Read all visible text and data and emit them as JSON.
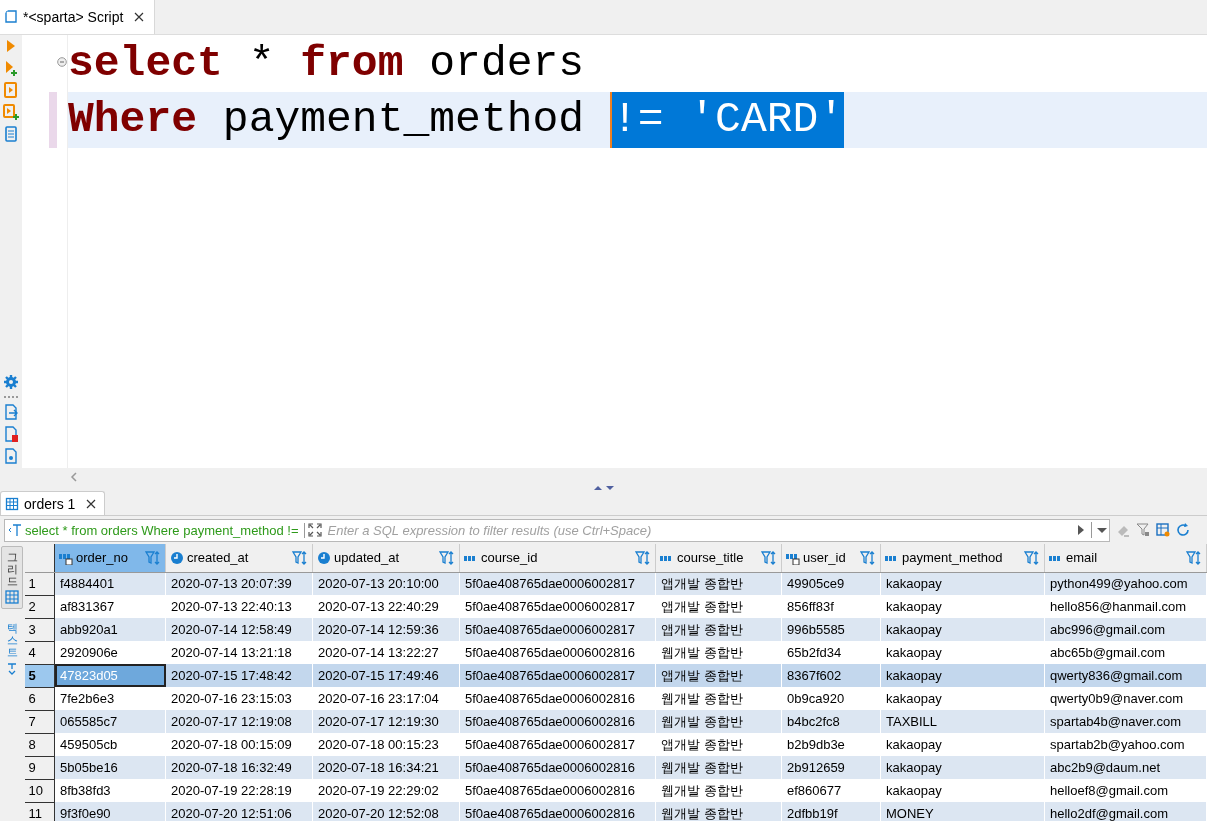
{
  "editor_tab": {
    "label": "*<sparta> Script",
    "selected": true
  },
  "editor": {
    "lines": [
      {
        "current": false,
        "folding": true,
        "changed": false,
        "tokens": [
          {
            "kind": "keyword",
            "text": "select"
          },
          {
            "kind": "plain",
            "text": " * "
          },
          {
            "kind": "keyword",
            "text": "from"
          },
          {
            "kind": "plain",
            "text": " orders"
          }
        ]
      },
      {
        "current": true,
        "folding": false,
        "changed": true,
        "tokens": [
          {
            "kind": "keyword",
            "text": "Where"
          },
          {
            "kind": "plain",
            "text": " payment_method "
          },
          {
            "kind": "selected",
            "text": "!= 'CARD'"
          }
        ]
      }
    ]
  },
  "results_tab": {
    "label": "orders 1",
    "selected": true
  },
  "filter": {
    "query": "select * from orders Where payment_method !=",
    "placeholder": "Enter a SQL expression to filter results (use Ctrl+Space)"
  },
  "view_tabs": [
    {
      "label": "그리드",
      "selected": true
    },
    {
      "label": "텍스트",
      "selected": false
    }
  ],
  "columns": [
    {
      "name": "order_no",
      "kind": "key",
      "selected": true
    },
    {
      "name": "created_at",
      "kind": "datetime",
      "selected": false
    },
    {
      "name": "updated_at",
      "kind": "datetime",
      "selected": false
    },
    {
      "name": "course_id",
      "kind": "text",
      "selected": false
    },
    {
      "name": "course_title",
      "kind": "text",
      "selected": false
    },
    {
      "name": "user_id",
      "kind": "key",
      "selected": false
    },
    {
      "name": "payment_method",
      "kind": "text",
      "selected": false
    },
    {
      "name": "email",
      "kind": "text",
      "selected": false
    }
  ],
  "rows": [
    {
      "number": "1",
      "selected": false,
      "cells": [
        "f4884401",
        "2020-07-13 20:07:39",
        "2020-07-13 20:10:00",
        "5f0ae408765dae0006002817",
        "앱개발 종합반",
        "49905ce9",
        "kakaopay",
        "python499@yahoo.com"
      ]
    },
    {
      "number": "2",
      "selected": false,
      "cells": [
        "af831367",
        "2020-07-13 22:40:13",
        "2020-07-13 22:40:29",
        "5f0ae408765dae0006002817",
        "앱개발 종합반",
        "856ff83f",
        "kakaopay",
        "hello856@hanmail.com"
      ]
    },
    {
      "number": "3",
      "selected": false,
      "cells": [
        "abb920a1",
        "2020-07-14 12:58:49",
        "2020-07-14 12:59:36",
        "5f0ae408765dae0006002817",
        "앱개발 종합반",
        "996b5585",
        "kakaopay",
        "abc996@gmail.com"
      ]
    },
    {
      "number": "4",
      "selected": false,
      "cells": [
        "2920906e",
        "2020-07-14 13:21:18",
        "2020-07-14 13:22:27",
        "5f0ae408765dae0006002816",
        "웹개발 종합반",
        "65b2fd34",
        "kakaopay",
        "abc65b@gmail.com"
      ]
    },
    {
      "number": "5",
      "selected": true,
      "cells": [
        "47823d05",
        "2020-07-15 17:48:42",
        "2020-07-15 17:49:46",
        "5f0ae408765dae0006002817",
        "앱개발 종합반",
        "8367f602",
        "kakaopay",
        "qwerty836@gmail.com"
      ]
    },
    {
      "number": "6",
      "selected": false,
      "cells": [
        "7fe2b6e3",
        "2020-07-16 23:15:03",
        "2020-07-16 23:17:04",
        "5f0ae408765dae0006002816",
        "웹개발 종합반",
        "0b9ca920",
        "kakaopay",
        "qwerty0b9@naver.com"
      ]
    },
    {
      "number": "7",
      "selected": false,
      "cells": [
        "065585c7",
        "2020-07-17 12:19:08",
        "2020-07-17 12:19:30",
        "5f0ae408765dae0006002816",
        "웹개발 종합반",
        "b4bc2fc8",
        "TAXBILL",
        "spartab4b@naver.com"
      ]
    },
    {
      "number": "8",
      "selected": false,
      "cells": [
        "459505cb",
        "2020-07-18 00:15:09",
        "2020-07-18 00:15:23",
        "5f0ae408765dae0006002817",
        "앱개발 종합반",
        "b2b9db3e",
        "kakaopay",
        "spartab2b@yahoo.com"
      ]
    },
    {
      "number": "9",
      "selected": false,
      "cells": [
        "5b05be16",
        "2020-07-18 16:32:49",
        "2020-07-18 16:34:21",
        "5f0ae408765dae0006002816",
        "웹개발 종합반",
        "2b912659",
        "kakaopay",
        "abc2b9@daum.net"
      ]
    },
    {
      "number": "10",
      "selected": false,
      "cells": [
        "8fb38fd3",
        "2020-07-19 22:28:19",
        "2020-07-19 22:29:02",
        "5f0ae408765dae0006002816",
        "웹개발 종합반",
        "ef860677",
        "kakaopay",
        "helloef8@gmail.com"
      ]
    },
    {
      "number": "11",
      "selected": false,
      "cells": [
        "9f3f0e90",
        "2020-07-20 12:51:06",
        "2020-07-20 12:52:08",
        "5f0ae408765dae0006002816",
        "웹개발 종합반",
        "2dfbb19f",
        "MONEY",
        "hello2df@gmail.com"
      ]
    }
  ]
}
